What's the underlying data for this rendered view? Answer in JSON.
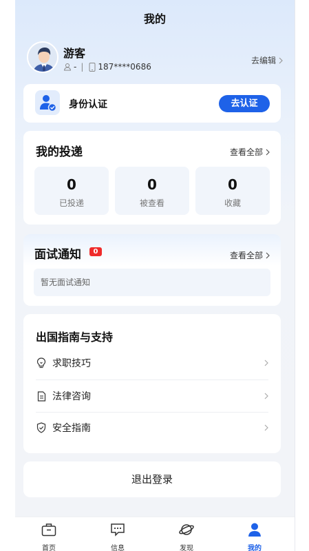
{
  "header": {
    "title": "我的"
  },
  "profile": {
    "name": "游客",
    "gender_value": "-",
    "phone": "187****0686",
    "edit_label": "去编辑"
  },
  "identity": {
    "label": "身份认证",
    "button_label": "去认证"
  },
  "deliveries": {
    "title": "我的投递",
    "view_all": "查看全部",
    "stats": [
      {
        "value": "0",
        "label": "已投递"
      },
      {
        "value": "0",
        "label": "被查看"
      },
      {
        "value": "0",
        "label": "收藏"
      }
    ]
  },
  "interviews": {
    "title": "面试通知",
    "badge": "0",
    "view_all": "查看全部",
    "empty_text": "暂无面试通知"
  },
  "guide": {
    "title": "出国指南与支持",
    "items": [
      {
        "label": "求职技巧",
        "icon": "lightbulb-icon"
      },
      {
        "label": "法律咨询",
        "icon": "document-icon"
      },
      {
        "label": "安全指南",
        "icon": "shield-check-icon"
      }
    ]
  },
  "logout": {
    "label": "退出登录"
  },
  "tabbar": {
    "items": [
      {
        "label": "首页",
        "icon": "briefcase-icon"
      },
      {
        "label": "信息",
        "icon": "message-icon"
      },
      {
        "label": "发现",
        "icon": "planet-icon"
      },
      {
        "label": "我的",
        "icon": "user-icon",
        "active": true
      }
    ]
  },
  "colors": {
    "accent": "#1e62e8",
    "badge": "#ef2b2b",
    "card_bg": "#ffffff",
    "page_bg": "#f2f4f8"
  }
}
